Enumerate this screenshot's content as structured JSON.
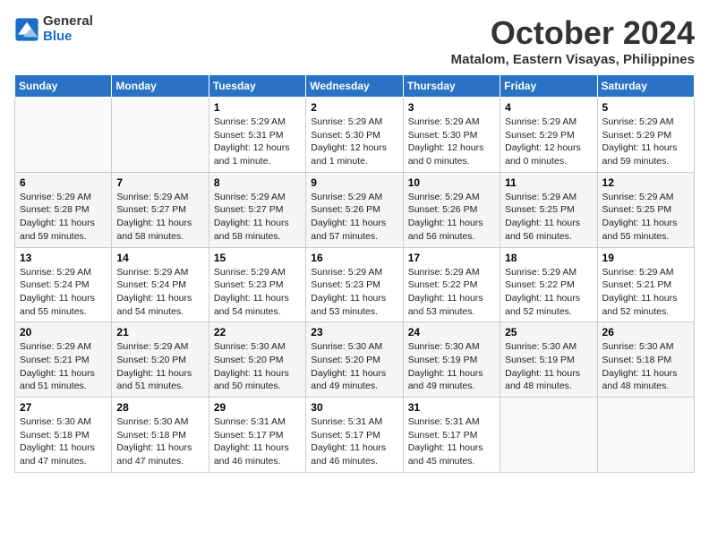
{
  "logo": {
    "general": "General",
    "blue": "Blue"
  },
  "title": "October 2024",
  "location": "Matalom, Eastern Visayas, Philippines",
  "headers": [
    "Sunday",
    "Monday",
    "Tuesday",
    "Wednesday",
    "Thursday",
    "Friday",
    "Saturday"
  ],
  "weeks": [
    [
      {
        "day": "",
        "info": ""
      },
      {
        "day": "",
        "info": ""
      },
      {
        "day": "1",
        "info": "Sunrise: 5:29 AM\nSunset: 5:31 PM\nDaylight: 12 hours and 1 minute."
      },
      {
        "day": "2",
        "info": "Sunrise: 5:29 AM\nSunset: 5:30 PM\nDaylight: 12 hours and 1 minute."
      },
      {
        "day": "3",
        "info": "Sunrise: 5:29 AM\nSunset: 5:30 PM\nDaylight: 12 hours and 0 minutes."
      },
      {
        "day": "4",
        "info": "Sunrise: 5:29 AM\nSunset: 5:29 PM\nDaylight: 12 hours and 0 minutes."
      },
      {
        "day": "5",
        "info": "Sunrise: 5:29 AM\nSunset: 5:29 PM\nDaylight: 11 hours and 59 minutes."
      }
    ],
    [
      {
        "day": "6",
        "info": "Sunrise: 5:29 AM\nSunset: 5:28 PM\nDaylight: 11 hours and 59 minutes."
      },
      {
        "day": "7",
        "info": "Sunrise: 5:29 AM\nSunset: 5:27 PM\nDaylight: 11 hours and 58 minutes."
      },
      {
        "day": "8",
        "info": "Sunrise: 5:29 AM\nSunset: 5:27 PM\nDaylight: 11 hours and 58 minutes."
      },
      {
        "day": "9",
        "info": "Sunrise: 5:29 AM\nSunset: 5:26 PM\nDaylight: 11 hours and 57 minutes."
      },
      {
        "day": "10",
        "info": "Sunrise: 5:29 AM\nSunset: 5:26 PM\nDaylight: 11 hours and 56 minutes."
      },
      {
        "day": "11",
        "info": "Sunrise: 5:29 AM\nSunset: 5:25 PM\nDaylight: 11 hours and 56 minutes."
      },
      {
        "day": "12",
        "info": "Sunrise: 5:29 AM\nSunset: 5:25 PM\nDaylight: 11 hours and 55 minutes."
      }
    ],
    [
      {
        "day": "13",
        "info": "Sunrise: 5:29 AM\nSunset: 5:24 PM\nDaylight: 11 hours and 55 minutes."
      },
      {
        "day": "14",
        "info": "Sunrise: 5:29 AM\nSunset: 5:24 PM\nDaylight: 11 hours and 54 minutes."
      },
      {
        "day": "15",
        "info": "Sunrise: 5:29 AM\nSunset: 5:23 PM\nDaylight: 11 hours and 54 minutes."
      },
      {
        "day": "16",
        "info": "Sunrise: 5:29 AM\nSunset: 5:23 PM\nDaylight: 11 hours and 53 minutes."
      },
      {
        "day": "17",
        "info": "Sunrise: 5:29 AM\nSunset: 5:22 PM\nDaylight: 11 hours and 53 minutes."
      },
      {
        "day": "18",
        "info": "Sunrise: 5:29 AM\nSunset: 5:22 PM\nDaylight: 11 hours and 52 minutes."
      },
      {
        "day": "19",
        "info": "Sunrise: 5:29 AM\nSunset: 5:21 PM\nDaylight: 11 hours and 52 minutes."
      }
    ],
    [
      {
        "day": "20",
        "info": "Sunrise: 5:29 AM\nSunset: 5:21 PM\nDaylight: 11 hours and 51 minutes."
      },
      {
        "day": "21",
        "info": "Sunrise: 5:29 AM\nSunset: 5:20 PM\nDaylight: 11 hours and 51 minutes."
      },
      {
        "day": "22",
        "info": "Sunrise: 5:30 AM\nSunset: 5:20 PM\nDaylight: 11 hours and 50 minutes."
      },
      {
        "day": "23",
        "info": "Sunrise: 5:30 AM\nSunset: 5:20 PM\nDaylight: 11 hours and 49 minutes."
      },
      {
        "day": "24",
        "info": "Sunrise: 5:30 AM\nSunset: 5:19 PM\nDaylight: 11 hours and 49 minutes."
      },
      {
        "day": "25",
        "info": "Sunrise: 5:30 AM\nSunset: 5:19 PM\nDaylight: 11 hours and 48 minutes."
      },
      {
        "day": "26",
        "info": "Sunrise: 5:30 AM\nSunset: 5:18 PM\nDaylight: 11 hours and 48 minutes."
      }
    ],
    [
      {
        "day": "27",
        "info": "Sunrise: 5:30 AM\nSunset: 5:18 PM\nDaylight: 11 hours and 47 minutes."
      },
      {
        "day": "28",
        "info": "Sunrise: 5:30 AM\nSunset: 5:18 PM\nDaylight: 11 hours and 47 minutes."
      },
      {
        "day": "29",
        "info": "Sunrise: 5:31 AM\nSunset: 5:17 PM\nDaylight: 11 hours and 46 minutes."
      },
      {
        "day": "30",
        "info": "Sunrise: 5:31 AM\nSunset: 5:17 PM\nDaylight: 11 hours and 46 minutes."
      },
      {
        "day": "31",
        "info": "Sunrise: 5:31 AM\nSunset: 5:17 PM\nDaylight: 11 hours and 45 minutes."
      },
      {
        "day": "",
        "info": ""
      },
      {
        "day": "",
        "info": ""
      }
    ]
  ]
}
